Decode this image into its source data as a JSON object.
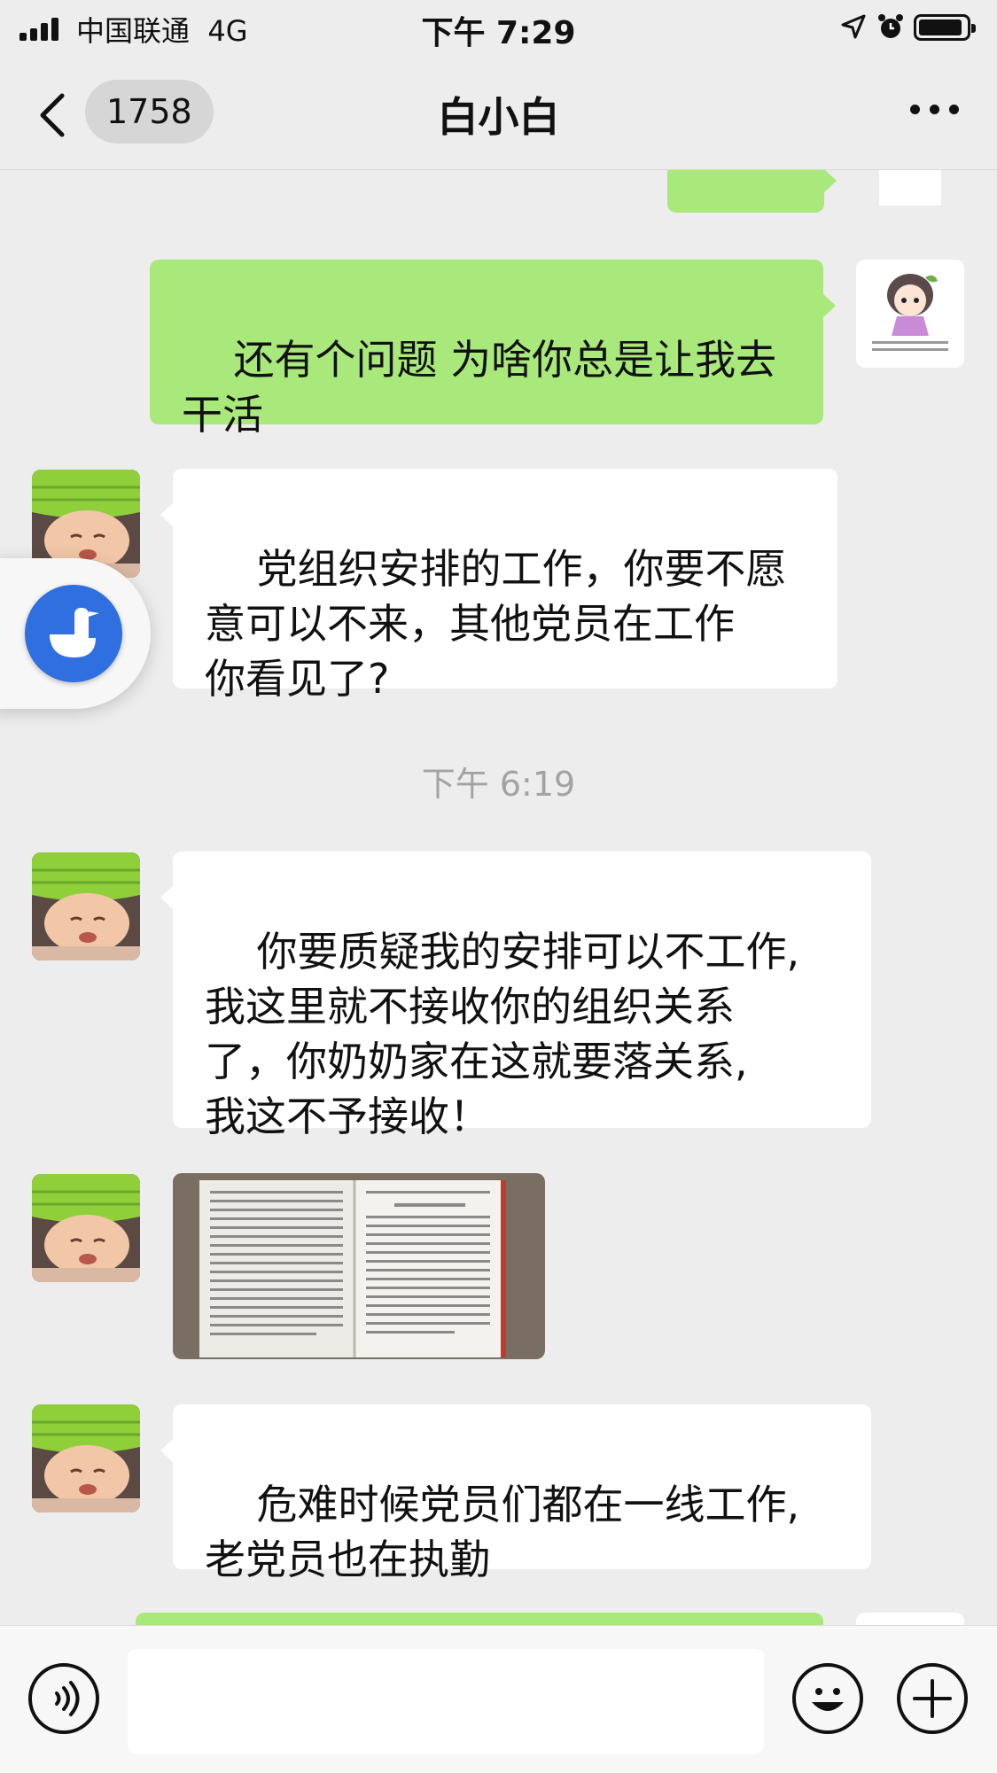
{
  "status_bar": {
    "carrier": "中国联通",
    "network": "4G",
    "time": "下午 7:29",
    "icons": [
      "signal-icon",
      "location-arrow-icon",
      "alarm-clock-icon",
      "battery-icon"
    ]
  },
  "nav": {
    "unread_count": "1758",
    "title": "白小白",
    "icons": [
      "back-chevron-icon",
      "more-dots-icon"
    ]
  },
  "messages": [
    {
      "direction": "out",
      "type": "text",
      "text": "…",
      "partial": true
    },
    {
      "direction": "out",
      "type": "text",
      "text": "还有个问题 为啥你总是让我去\n干活"
    },
    {
      "direction": "in",
      "type": "text",
      "text": "党组织安排的工作，你要不愿\n意可以不来，其他党员在工作\n你看见了?"
    },
    {
      "direction": "in",
      "type": "text",
      "text": "你要质疑我的安排可以不工作,\n我这里就不接收你的组织关系\n了，你奶奶家在这就要落关系,\n我这不予接收！"
    },
    {
      "direction": "in",
      "type": "image",
      "description_icon": "book-photo-thumbnail"
    },
    {
      "direction": "in",
      "type": "text",
      "text": "危难时候党员们都在一线工作,\n老党员也在执勤"
    }
  ],
  "timestamp": "下午 6:19",
  "input_bar": {
    "text_value": "",
    "icons": [
      "voice-icon",
      "emoji-icon",
      "plus-icon"
    ]
  },
  "floating_widget": {
    "icon": "goose-app-icon"
  },
  "colors": {
    "background": "#ededed",
    "outgoing_bubble": "#a9e87a",
    "incoming_bubble": "#ffffff",
    "timestamp_text": "#a3a3a3",
    "widget_blue": "#2f6fe0"
  }
}
